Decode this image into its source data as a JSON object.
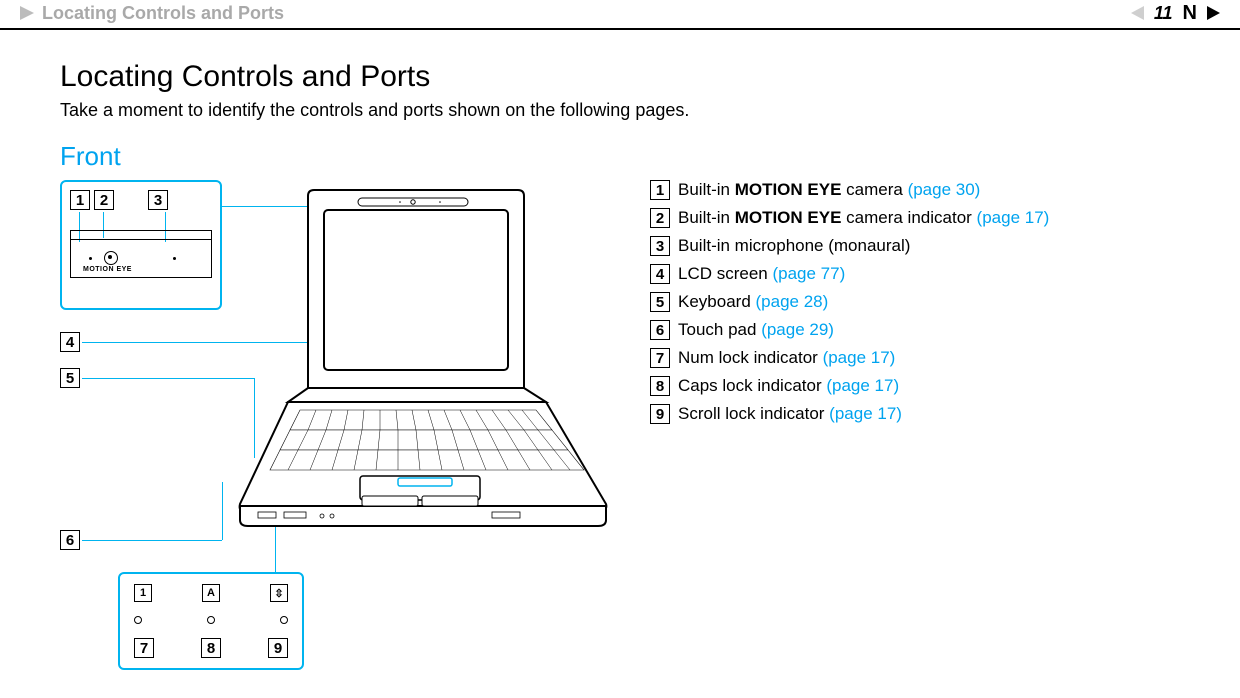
{
  "header": {
    "breadcrumb": "Locating Controls and Ports",
    "page_number": "11",
    "nav_marker": "N"
  },
  "page": {
    "title": "Locating Controls and Ports",
    "intro": "Take a moment to identify the controls and ports shown on the following pages.",
    "section": "Front"
  },
  "top_detail": {
    "n1": "1",
    "n2": "2",
    "n3": "3",
    "motion_eye": "MOTION EYE"
  },
  "side_labels": {
    "n4": "4",
    "n5": "5",
    "n6": "6"
  },
  "indicator_detail": {
    "icon1": "1",
    "iconA": "A",
    "iconScroll": "⇳",
    "n7": "7",
    "n8": "8",
    "n9": "9"
  },
  "legend": [
    {
      "num": "1",
      "before": "Built-in ",
      "bold": "MOTION EYE",
      "after": " camera ",
      "link": "(page 30)"
    },
    {
      "num": "2",
      "before": "Built-in ",
      "bold": "MOTION EYE",
      "after": " camera indicator ",
      "link": "(page 17)"
    },
    {
      "num": "3",
      "before": "Built-in microphone (monaural)",
      "bold": "",
      "after": "",
      "link": ""
    },
    {
      "num": "4",
      "before": "LCD screen ",
      "bold": "",
      "after": "",
      "link": "(page 77)"
    },
    {
      "num": "5",
      "before": "Keyboard ",
      "bold": "",
      "after": "",
      "link": "(page 28)"
    },
    {
      "num": "6",
      "before": "Touch pad ",
      "bold": "",
      "after": "",
      "link": "(page 29)"
    },
    {
      "num": "7",
      "before": "Num lock indicator ",
      "bold": "",
      "after": "",
      "link": "(page 17)"
    },
    {
      "num": "8",
      "before": "Caps lock indicator ",
      "bold": "",
      "after": "",
      "link": "(page 17)"
    },
    {
      "num": "9",
      "before": "Scroll lock indicator ",
      "bold": "",
      "after": "",
      "link": "(page 17)"
    }
  ]
}
